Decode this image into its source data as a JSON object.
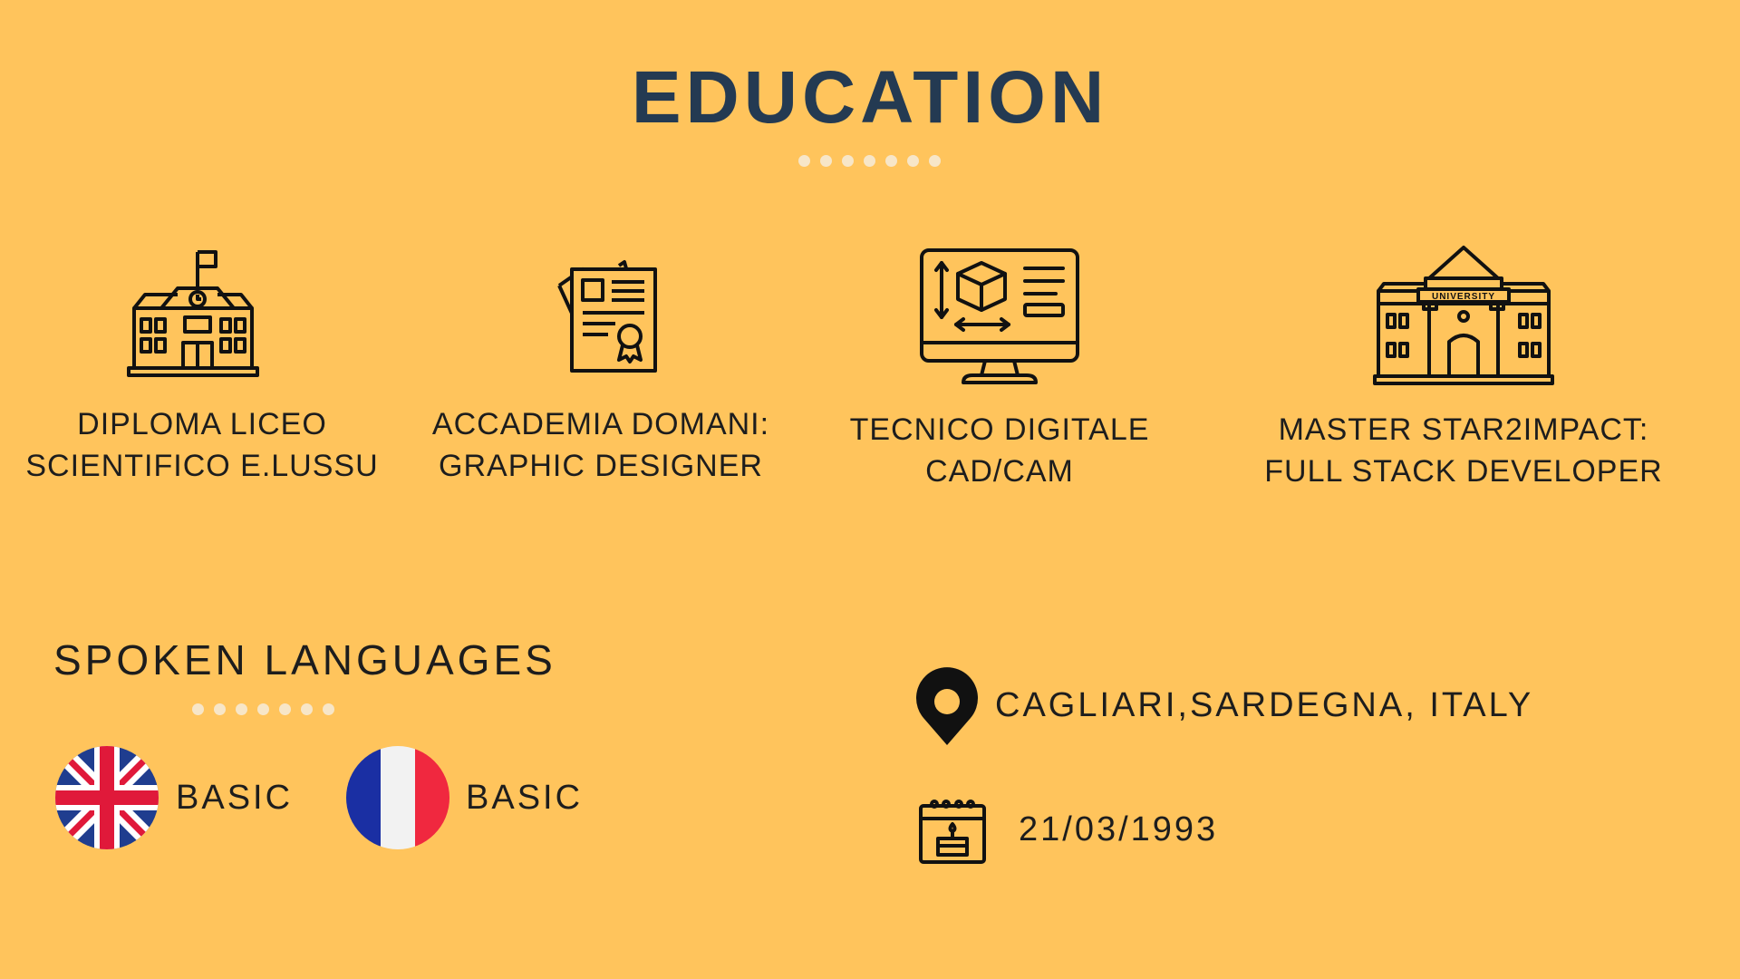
{
  "header": {
    "title": "EDUCATION"
  },
  "education": [
    {
      "label": "DIPLOMA LICEO SCIENTIFICO E.LUSSU",
      "icon": "school-icon"
    },
    {
      "label": "ACCADEMIA DOMANI: GRAPHIC DESIGNER",
      "icon": "certificate-icon"
    },
    {
      "label": "TECNICO DIGITALE CAD/CAM",
      "icon": "cad-monitor-icon"
    },
    {
      "label": "MASTER STAR2IMPACT: FULL STACK DEVELOPER",
      "icon": "university-icon",
      "sign": "UNIVERSITY"
    }
  ],
  "languages": {
    "title": "SPOKEN LANGUAGES",
    "items": [
      {
        "flag": "uk-flag-icon",
        "level": "BASIC"
      },
      {
        "flag": "france-flag-icon",
        "level": "BASIC"
      }
    ]
  },
  "info": {
    "location": "CAGLIARI,SARDEGNA, ITALY",
    "birthdate": "21/03/1993"
  },
  "colors": {
    "background": "#ffc45c",
    "title": "#243a52",
    "dots": "#f7e6c8",
    "text": "#1d1d1d"
  }
}
